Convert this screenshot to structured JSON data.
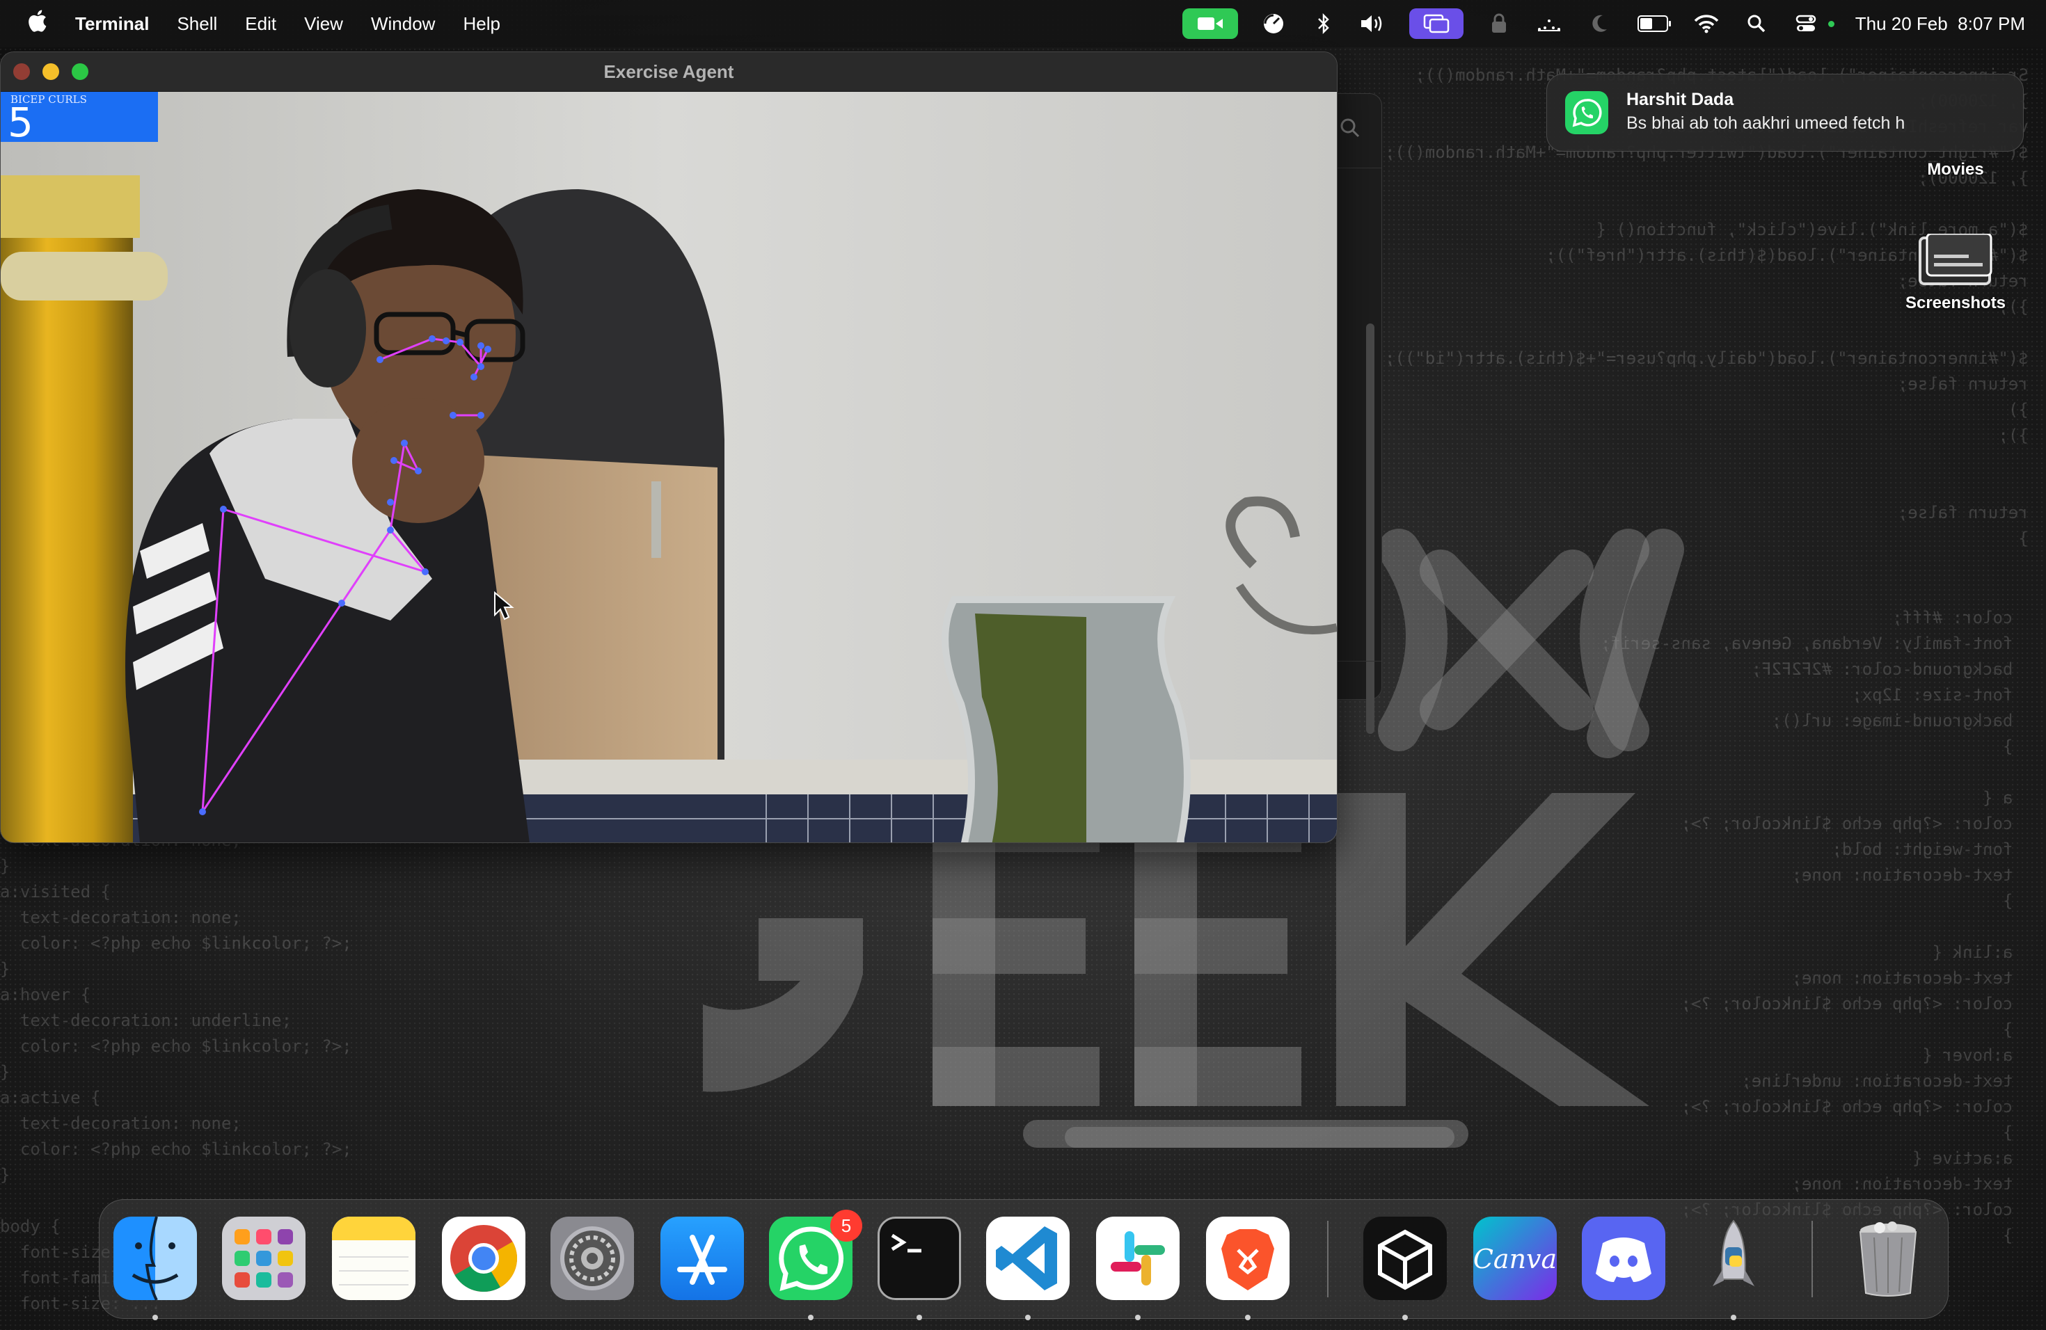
{
  "menubar": {
    "app_name": "Terminal",
    "menus": [
      "Shell",
      "Edit",
      "View",
      "Window",
      "Help"
    ],
    "datetime": "Thu 20 Feb  8:07 PM",
    "battery_level": 0.5
  },
  "window": {
    "title": "Exercise Agent",
    "counter_label": "BICEP CURLS",
    "counter_value": "5"
  },
  "notification": {
    "app_icon": "whatsapp-icon",
    "sender": "Harshit Dada",
    "message": "Bs bhai ab toh aakhri umeed fetch h"
  },
  "desktop": {
    "items": [
      {
        "label": "Movies",
        "icon": "folder-icon"
      },
      {
        "label": "Screenshots",
        "icon": "folder-icon"
      }
    ]
  },
  "dock": {
    "whatsapp_badge": "5",
    "apps": [
      "Finder",
      "Launchpad",
      "Notes",
      "Google Chrome",
      "System Settings",
      "App Store",
      "WhatsApp",
      "Terminal",
      "Visual Studio Code",
      "Slack",
      "Brave Browser",
      "Unity Hub",
      "Canva",
      "Discord",
      "Python Launcher",
      "Trash"
    ]
  },
  "colors": {
    "accent_blue": "#1b6ef3",
    "whatsapp_green": "#25d366",
    "pose_magenta": "#e040fb",
    "badge_red": "#ff3b30"
  }
}
